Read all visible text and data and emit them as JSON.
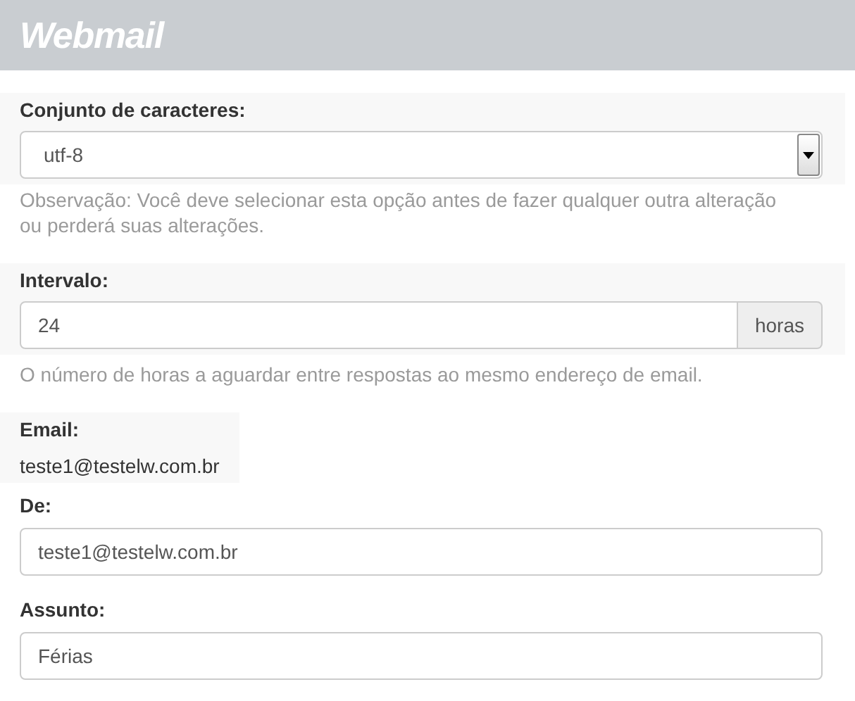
{
  "header": {
    "logo": "Webmail"
  },
  "charset": {
    "label": "Conjunto de caracteres:",
    "value": "utf-8",
    "hint": "Observação: Você deve selecionar esta opção antes de fazer qualquer outra alteração ou perderá suas alterações."
  },
  "interval": {
    "label": "Intervalo:",
    "value": "24",
    "unit": "horas",
    "hint": "O número de horas a aguardar entre respostas ao mesmo endereço de email."
  },
  "email": {
    "label": "Email:",
    "value": "teste1@testelw.com.br"
  },
  "from": {
    "label": "De:",
    "value": "teste1@testelw.com.br"
  },
  "subject": {
    "label": "Assunto:",
    "value": "Férias"
  }
}
